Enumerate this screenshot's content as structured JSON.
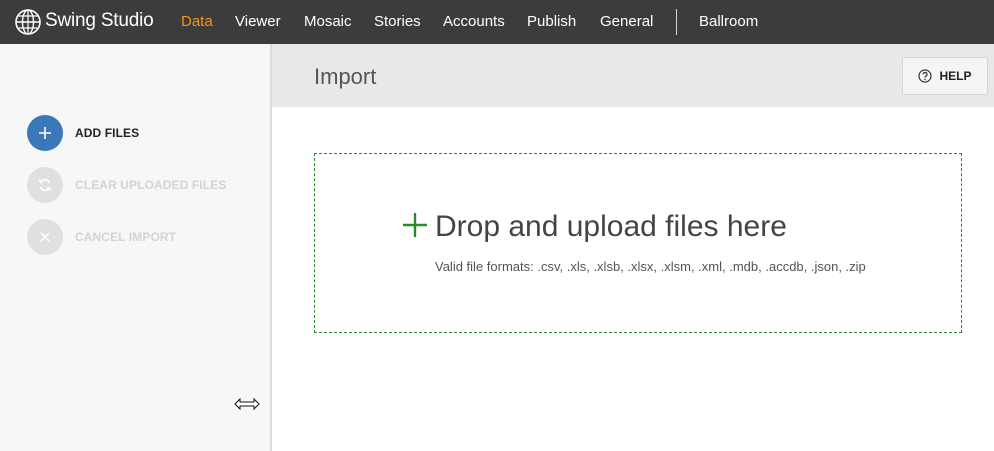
{
  "app": {
    "name": "Swing Studio"
  },
  "nav": {
    "items": [
      {
        "label": "Data",
        "active": true
      },
      {
        "label": "Viewer",
        "active": false
      },
      {
        "label": "Mosaic",
        "active": false
      },
      {
        "label": "Stories",
        "active": false
      },
      {
        "label": "Accounts",
        "active": false
      },
      {
        "label": "Publish",
        "active": false
      },
      {
        "label": "General",
        "active": false
      }
    ],
    "workspace": "Ballroom"
  },
  "sidebar": {
    "actions": [
      {
        "label": "ADD FILES",
        "icon": "plus-icon",
        "enabled": true
      },
      {
        "label": "CLEAR UPLOADED FILES",
        "icon": "refresh-icon",
        "enabled": false
      },
      {
        "label": "CANCEL IMPORT",
        "icon": "close-icon",
        "enabled": false
      }
    ]
  },
  "header": {
    "title": "Import",
    "help_label": "HELP"
  },
  "dropzone": {
    "title": "Drop and upload files here",
    "formats": "Valid file formats: .csv, .xls, .xlsb, .xlsx, .xlsm, .xml, .mdb, .accdb, .json, .zip"
  },
  "colors": {
    "topbar": "#3c3c3c",
    "nav_active": "#f7941d",
    "primary_button": "#3b78b7",
    "dropzone_border": "#2a8a2a"
  }
}
